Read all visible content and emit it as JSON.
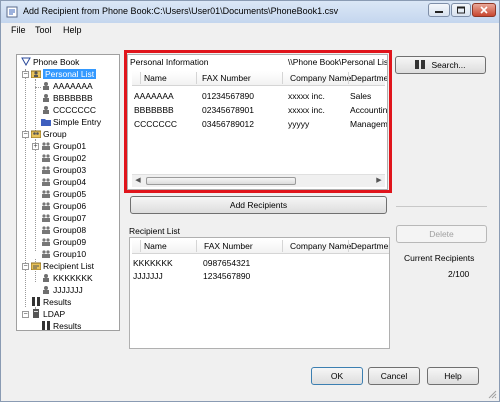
{
  "window": {
    "title": "Add Recipient from Phone Book:C:\\Users\\User01\\Documents\\PhoneBook1.csv"
  },
  "menu": {
    "file": "File",
    "tool": "Tool",
    "help": "Help"
  },
  "tree": {
    "phone_book": "Phone Book",
    "personal_list": "Personal List",
    "personal_entries": [
      "AAAAAAA",
      "BBBBBBB",
      "CCCCCCC"
    ],
    "simple_entry": "Simple Entry",
    "group": "Group",
    "groups": [
      "Group01",
      "Group02",
      "Group03",
      "Group04",
      "Group05",
      "Group06",
      "Group07",
      "Group08",
      "Group09",
      "Group10"
    ],
    "recipient_list": "Recipient List",
    "recipient_entries": [
      "KKKKKKK",
      "JJJJJJJ"
    ],
    "results": "Results",
    "ldap": "LDAP",
    "ldap_results": "Results"
  },
  "personal_info": {
    "heading": "Personal Information",
    "path": "\\\\Phone Book\\Personal List",
    "columns": [
      "Name",
      "FAX Number",
      "Company Name",
      "Departmen"
    ],
    "rows": [
      [
        "AAAAAAA",
        "01234567890",
        "xxxxx inc.",
        "Sales"
      ],
      [
        "BBBBBBB",
        "02345678901",
        "xxxxx inc.",
        "Accounting"
      ],
      [
        "CCCCCCC",
        "03456789012",
        "yyyyy",
        "Manageme"
      ]
    ]
  },
  "buttons": {
    "search": "Search...",
    "add_recipients": "Add Recipients",
    "delete": "Delete",
    "ok": "OK",
    "cancel": "Cancel",
    "help": "Help"
  },
  "recipient_list": {
    "heading": "Recipient List",
    "columns": [
      "Name",
      "FAX Number",
      "Company Name",
      "Departmen"
    ],
    "rows": [
      [
        "KKKKKKK",
        "0987654321"
      ],
      [
        "JJJJJJJ",
        "1234567890"
      ]
    ]
  },
  "current_recipients": {
    "label": "Current Recipients",
    "value": "2/100"
  },
  "colors": {
    "highlight": "#e0141b",
    "selection": "#3399ff"
  }
}
